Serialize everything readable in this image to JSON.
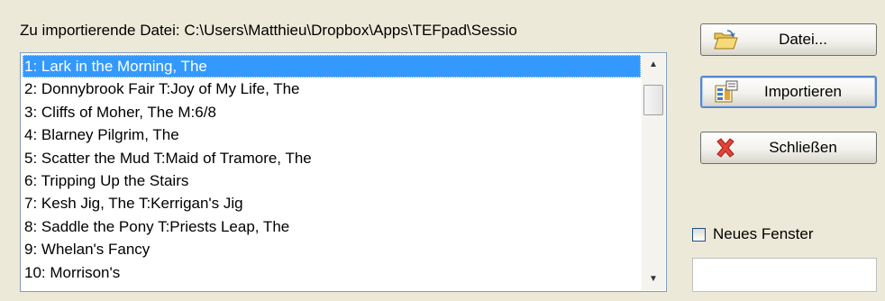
{
  "file_label": "Zu importierende Datei: C:\\Users\\Matthieu\\Dropbox\\Apps\\TEFpad\\Sessio",
  "tunes": [
    "1: Lark in the Morning, The",
    "2: Donnybrook Fair T:Joy of My Life, The",
    "3: Cliffs of Moher, The M:6/8",
    "4: Blarney Pilgrim, The",
    "5: Scatter the Mud T:Maid of Tramore, The",
    "6: Tripping Up the Stairs",
    "7: Kesh Jig, The T:Kerrigan's Jig",
    "8: Saddle the Pony T:Priests Leap, The",
    "9: Whelan's Fancy",
    "10: Morrison's"
  ],
  "selected_index": 0,
  "buttons": {
    "file": "Datei...",
    "import": "Importieren",
    "close": "Schließen"
  },
  "icons": {
    "file": "open-folder-icon",
    "import": "import-document-icon",
    "close": "red-x-icon"
  },
  "new_window": {
    "label": "Neues Fenster",
    "checked": false
  },
  "colors": {
    "selection": "#3399ff",
    "background": "#ece9d8",
    "focus_border": "#5b86c9"
  }
}
